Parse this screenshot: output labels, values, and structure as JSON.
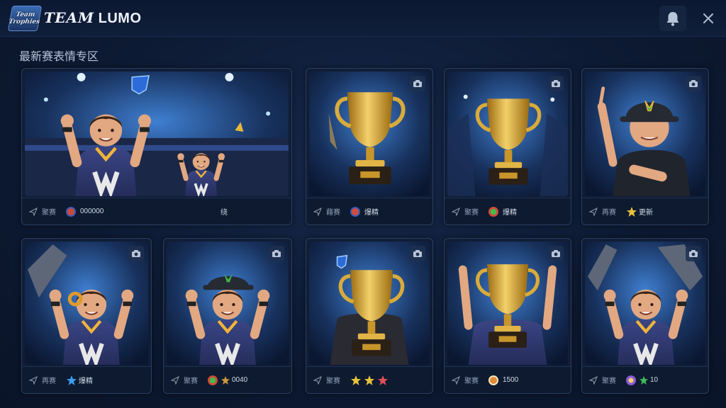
{
  "header": {
    "logo_text_top": "Team",
    "logo_text_bottom": "Trophies",
    "brand_prefix": "ТЕАМ",
    "brand_name": "LUMO"
  },
  "section_title": "最新赛表情专区",
  "cards": [
    {
      "category": "聚赛",
      "value": "000000",
      "extra": "绕"
    },
    {
      "category": "藉赛",
      "value": "爆精"
    },
    {
      "category": "聚赛",
      "value": "爆精"
    },
    {
      "category": "再赛",
      "value": "更新"
    },
    {
      "category": "再赛",
      "value": "爆精"
    },
    {
      "category": "聚赛",
      "value": "0040"
    },
    {
      "category": "聚赛",
      "value": ""
    },
    {
      "category": "聚赛",
      "value": "1500"
    },
    {
      "category": "聚赛",
      "value": "10"
    }
  ],
  "colors": {
    "background": "#0d1a33",
    "card": "#101d36",
    "gold": "#e6b93a",
    "jersey": "#37407a",
    "accent_blue": "#4aa8ff"
  }
}
